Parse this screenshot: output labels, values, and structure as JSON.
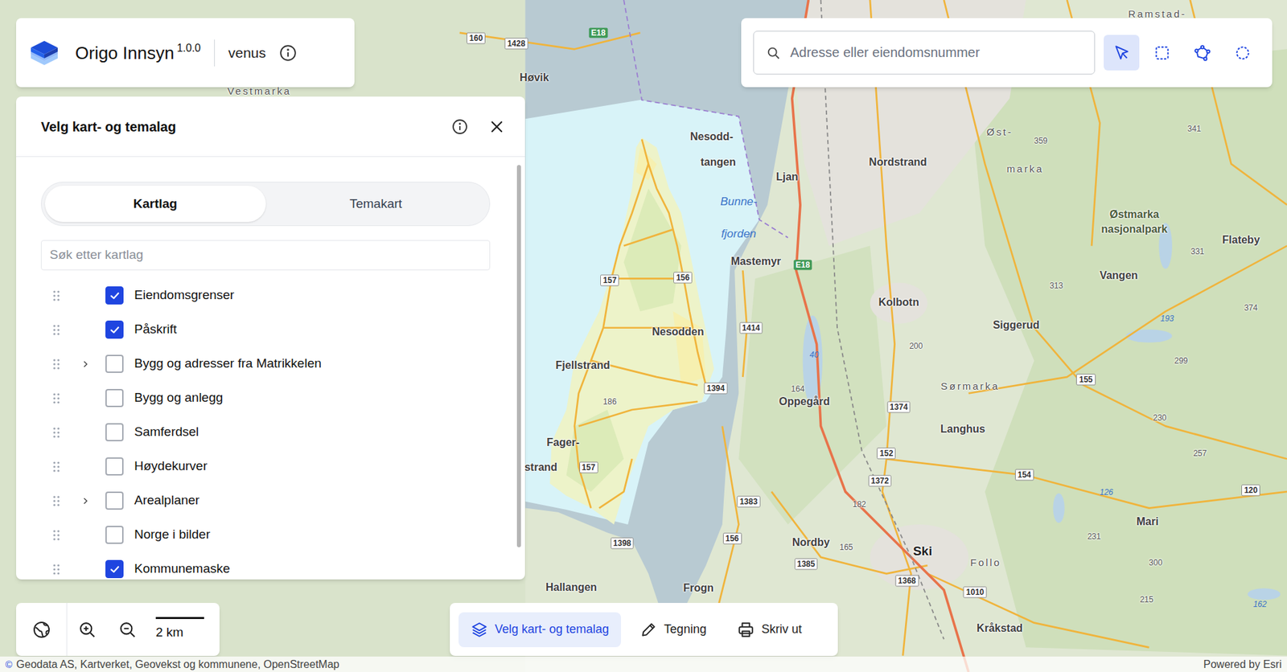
{
  "header": {
    "title": "Origo Innsyn",
    "version": "1.0.0",
    "workspace": "venus"
  },
  "search": {
    "placeholder": "Adresse eller eiendomsnummer"
  },
  "tools": [
    {
      "kind": "pointer",
      "selected": true
    },
    {
      "kind": "rectangle",
      "selected": false
    },
    {
      "kind": "polygon",
      "selected": false
    },
    {
      "kind": "circle",
      "selected": false
    }
  ],
  "layer_panel": {
    "title": "Velg kart- og temalag",
    "tabs": [
      {
        "label": "Kartlag",
        "selected": true
      },
      {
        "label": "Temakart",
        "selected": false
      }
    ],
    "search_placeholder": "Søk etter kartlag",
    "layers": [
      {
        "label": "Eiendomsgrenser",
        "checked": true,
        "expandable": false
      },
      {
        "label": "Påskrift",
        "checked": true,
        "expandable": false
      },
      {
        "label": "Bygg og adresser fra Matrikkelen",
        "checked": false,
        "expandable": true
      },
      {
        "label": "Bygg og anlegg",
        "checked": false,
        "expandable": false
      },
      {
        "label": "Samferdsel",
        "checked": false,
        "expandable": false
      },
      {
        "label": "Høydekurver",
        "checked": false,
        "expandable": false
      },
      {
        "label": "Arealplaner",
        "checked": false,
        "expandable": true
      },
      {
        "label": "Norge i bilder",
        "checked": false,
        "expandable": false
      },
      {
        "label": "Kommunemaske",
        "checked": true,
        "expandable": false
      }
    ]
  },
  "scale": "2 km",
  "toolbar": [
    {
      "label": "Velg kart- og temalag",
      "kind": "layers",
      "selected": true
    },
    {
      "label": "Tegning",
      "kind": "pencil",
      "selected": false
    },
    {
      "label": "Skriv ut",
      "kind": "printer",
      "selected": false
    }
  ],
  "attribution": {
    "symbol": "©",
    "text": "Geodata AS, Kartverket, Geovekst og kommunene, OpenStreetMap",
    "powered_by": "Powered by Esri"
  },
  "map_labels": [
    {
      "text": "Høvik",
      "kind": "place"
    },
    {
      "text": "Nesodd-",
      "kind": "place"
    },
    {
      "text": "tangen",
      "kind": "place"
    },
    {
      "text": "Ljan",
      "kind": "place"
    },
    {
      "text": "Nordstrand",
      "kind": "place"
    },
    {
      "text": "Bunne-",
      "kind": "water"
    },
    {
      "text": "fjorden",
      "kind": "water"
    },
    {
      "text": "Mastemyr",
      "kind": "place"
    },
    {
      "text": "Nesodden",
      "kind": "place"
    },
    {
      "text": "Fjellstrand",
      "kind": "place"
    },
    {
      "text": "Fager-",
      "kind": "place"
    },
    {
      "text": "strand",
      "kind": "place"
    },
    {
      "text": "Kolbotn",
      "kind": "place"
    },
    {
      "text": "Oppegård",
      "kind": "place"
    },
    {
      "text": "Siggerud",
      "kind": "place"
    },
    {
      "text": "Langhus",
      "kind": "place"
    },
    {
      "text": "Nordby",
      "kind": "place"
    },
    {
      "text": "Ski",
      "kind": "town"
    },
    {
      "text": "Frogn",
      "kind": "place"
    },
    {
      "text": "Hallangen",
      "kind": "place"
    },
    {
      "text": "Kråkstad",
      "kind": "place"
    },
    {
      "text": "Mari",
      "kind": "place"
    },
    {
      "text": "Follo",
      "kind": "area"
    },
    {
      "text": "Sørmarka",
      "kind": "area"
    },
    {
      "text": "Øst-",
      "kind": "area"
    },
    {
      "text": "marka",
      "kind": "area"
    },
    {
      "text": "Østmarka",
      "kind": "park"
    },
    {
      "text": "nasjonalpark",
      "kind": "park"
    },
    {
      "text": "Vangen",
      "kind": "place"
    },
    {
      "text": "Flateby",
      "kind": "place"
    },
    {
      "text": "Vestmarka",
      "kind": "area"
    },
    {
      "text": "Ramstad-",
      "kind": "area"
    },
    {
      "text": "E18",
      "kind": "motorway"
    },
    {
      "text": "E18",
      "kind": "motorway"
    },
    {
      "text": "157",
      "kind": "road"
    },
    {
      "text": "156",
      "kind": "road"
    },
    {
      "text": "1414",
      "kind": "road"
    },
    {
      "text": "1394",
      "kind": "road"
    },
    {
      "text": "157",
      "kind": "road"
    },
    {
      "text": "1398",
      "kind": "road"
    },
    {
      "text": "156",
      "kind": "road"
    },
    {
      "text": "1383",
      "kind": "road"
    },
    {
      "text": "1385",
      "kind": "road"
    },
    {
      "text": "1374",
      "kind": "road"
    },
    {
      "text": "152",
      "kind": "road"
    },
    {
      "text": "1372",
      "kind": "road"
    },
    {
      "text": "1368",
      "kind": "road"
    },
    {
      "text": "1010",
      "kind": "road"
    },
    {
      "text": "154",
      "kind": "road"
    },
    {
      "text": "155",
      "kind": "road"
    },
    {
      "text": "1428",
      "kind": "road"
    },
    {
      "text": "160",
      "kind": "road"
    },
    {
      "text": "186",
      "kind": "height"
    },
    {
      "text": "164",
      "kind": "height"
    },
    {
      "text": "182",
      "kind": "height"
    },
    {
      "text": "165",
      "kind": "height"
    },
    {
      "text": "200",
      "kind": "height"
    },
    {
      "text": "359",
      "kind": "height"
    },
    {
      "text": "341",
      "kind": "height"
    },
    {
      "text": "313",
      "kind": "height"
    },
    {
      "text": "331",
      "kind": "height"
    },
    {
      "text": "299",
      "kind": "height"
    },
    {
      "text": "230",
      "kind": "height"
    },
    {
      "text": "257",
      "kind": "height"
    },
    {
      "text": "231",
      "kind": "height"
    },
    {
      "text": "300",
      "kind": "height"
    },
    {
      "text": "215",
      "kind": "height"
    },
    {
      "text": "120",
      "kind": "road"
    },
    {
      "text": "374",
      "kind": "height"
    },
    {
      "text": "40",
      "kind": "waternum"
    },
    {
      "text": "193",
      "kind": "waternum"
    },
    {
      "text": "126",
      "kind": "waternum"
    },
    {
      "text": "162",
      "kind": "waternum"
    }
  ]
}
